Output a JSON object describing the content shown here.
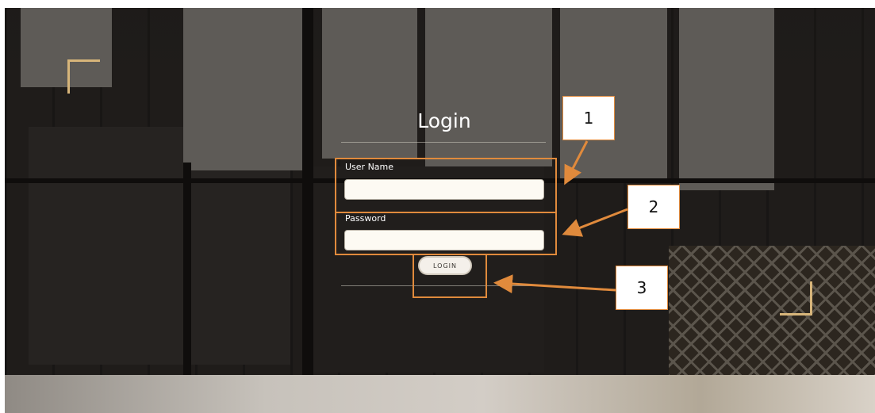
{
  "form": {
    "title": "Login",
    "username_label": "User Name",
    "username_value": "",
    "password_label": "Password",
    "password_value": "",
    "login_button": "LOGIN"
  },
  "annotations": {
    "callout_1": "1",
    "callout_2": "2",
    "callout_3": "3"
  },
  "colors": {
    "annotation": "#e08a3c",
    "corner_accent": "#d7b57a"
  }
}
